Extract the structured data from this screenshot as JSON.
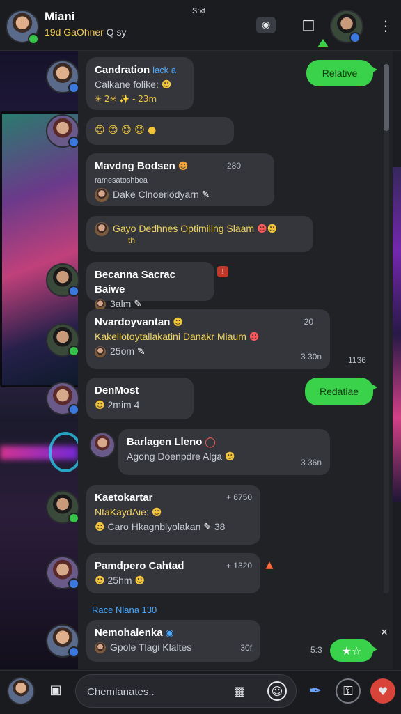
{
  "header": {
    "title": "Miani",
    "subtitle_highlight": "19d GaOhner",
    "subtitle_rest": "Q sy",
    "center_text": "S:xt"
  },
  "outgoing": [
    {
      "text": "Relative"
    },
    {
      "text": "Redatiae"
    },
    {
      "text": "★☆"
    }
  ],
  "messages": [
    {
      "name": "Candration",
      "tag": "lack a",
      "line1": "Calkane folike:",
      "line2": "✳ 2✳ ✨ - 23m"
    },
    {
      "line1": "😊 😊 😊 😊 ●"
    },
    {
      "name": "Mavdng Bodsen",
      "time": "280",
      "line1": "ramesatoshbea",
      "line2": "Dake Clnoerlödyarn"
    },
    {
      "line1": "Gayo Dedhnes Optimiling Slaam",
      "line2": "th"
    },
    {
      "name": "Becanna Sacrac Baiwe",
      "line1": "3alm"
    },
    {
      "name": "Nvardoyvantan",
      "time": "20",
      "line1": "Kakellotoytallakatini Danakr",
      "line1b": "Miaum",
      "line2": "25om",
      "time2": "3.30n",
      "time3": "1136"
    },
    {
      "name": "DenMost",
      "line1": "2mim 4"
    },
    {
      "name": "Barlagen Lleno",
      "line1": "Agong Doenpdre Alga",
      "time": "3.36n"
    },
    {
      "name": "Kaetokartar",
      "time": "+ 6750",
      "line1": "NtaKaydAie:",
      "line2": "Caro Hkagnblyolakan",
      "line2b": "38"
    },
    {
      "name": "Pamdpero Cahtad",
      "time": "+ 1320",
      "line1": "25hm"
    },
    {
      "name": "Nemohalenka",
      "line1": "Gpole Tlagi Klaltes",
      "time": "30f",
      "time_left": "5:3"
    }
  ],
  "section_label": "Race Nlana 130",
  "input": {
    "placeholder": "Chemlanates.."
  },
  "colors": {
    "accent_green": "#3ad24a",
    "accent_blue": "#4aa8ff",
    "panel": "#202226",
    "bubble": "#34363b"
  }
}
